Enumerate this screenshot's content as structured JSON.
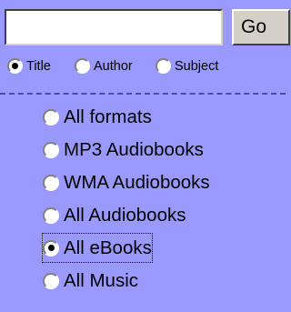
{
  "search": {
    "value": "",
    "placeholder": "",
    "go_label": "Go"
  },
  "scope": {
    "selected": "Title",
    "options": [
      {
        "label": "Title",
        "checked": true
      },
      {
        "label": "Author",
        "checked": false
      },
      {
        "label": "Subject",
        "checked": false
      }
    ]
  },
  "formats": {
    "selected": "All eBooks",
    "options": [
      {
        "label": "All formats",
        "checked": false
      },
      {
        "label": "MP3 Audiobooks",
        "checked": false
      },
      {
        "label": "WMA Audiobooks",
        "checked": false
      },
      {
        "label": "All Audiobooks",
        "checked": false
      },
      {
        "label": "All eBooks",
        "checked": true
      },
      {
        "label": "All Music",
        "checked": false
      }
    ]
  },
  "colors": {
    "background": "#9999ff",
    "divider": "#4a4aa8",
    "button_face": "#d4d0c8"
  }
}
